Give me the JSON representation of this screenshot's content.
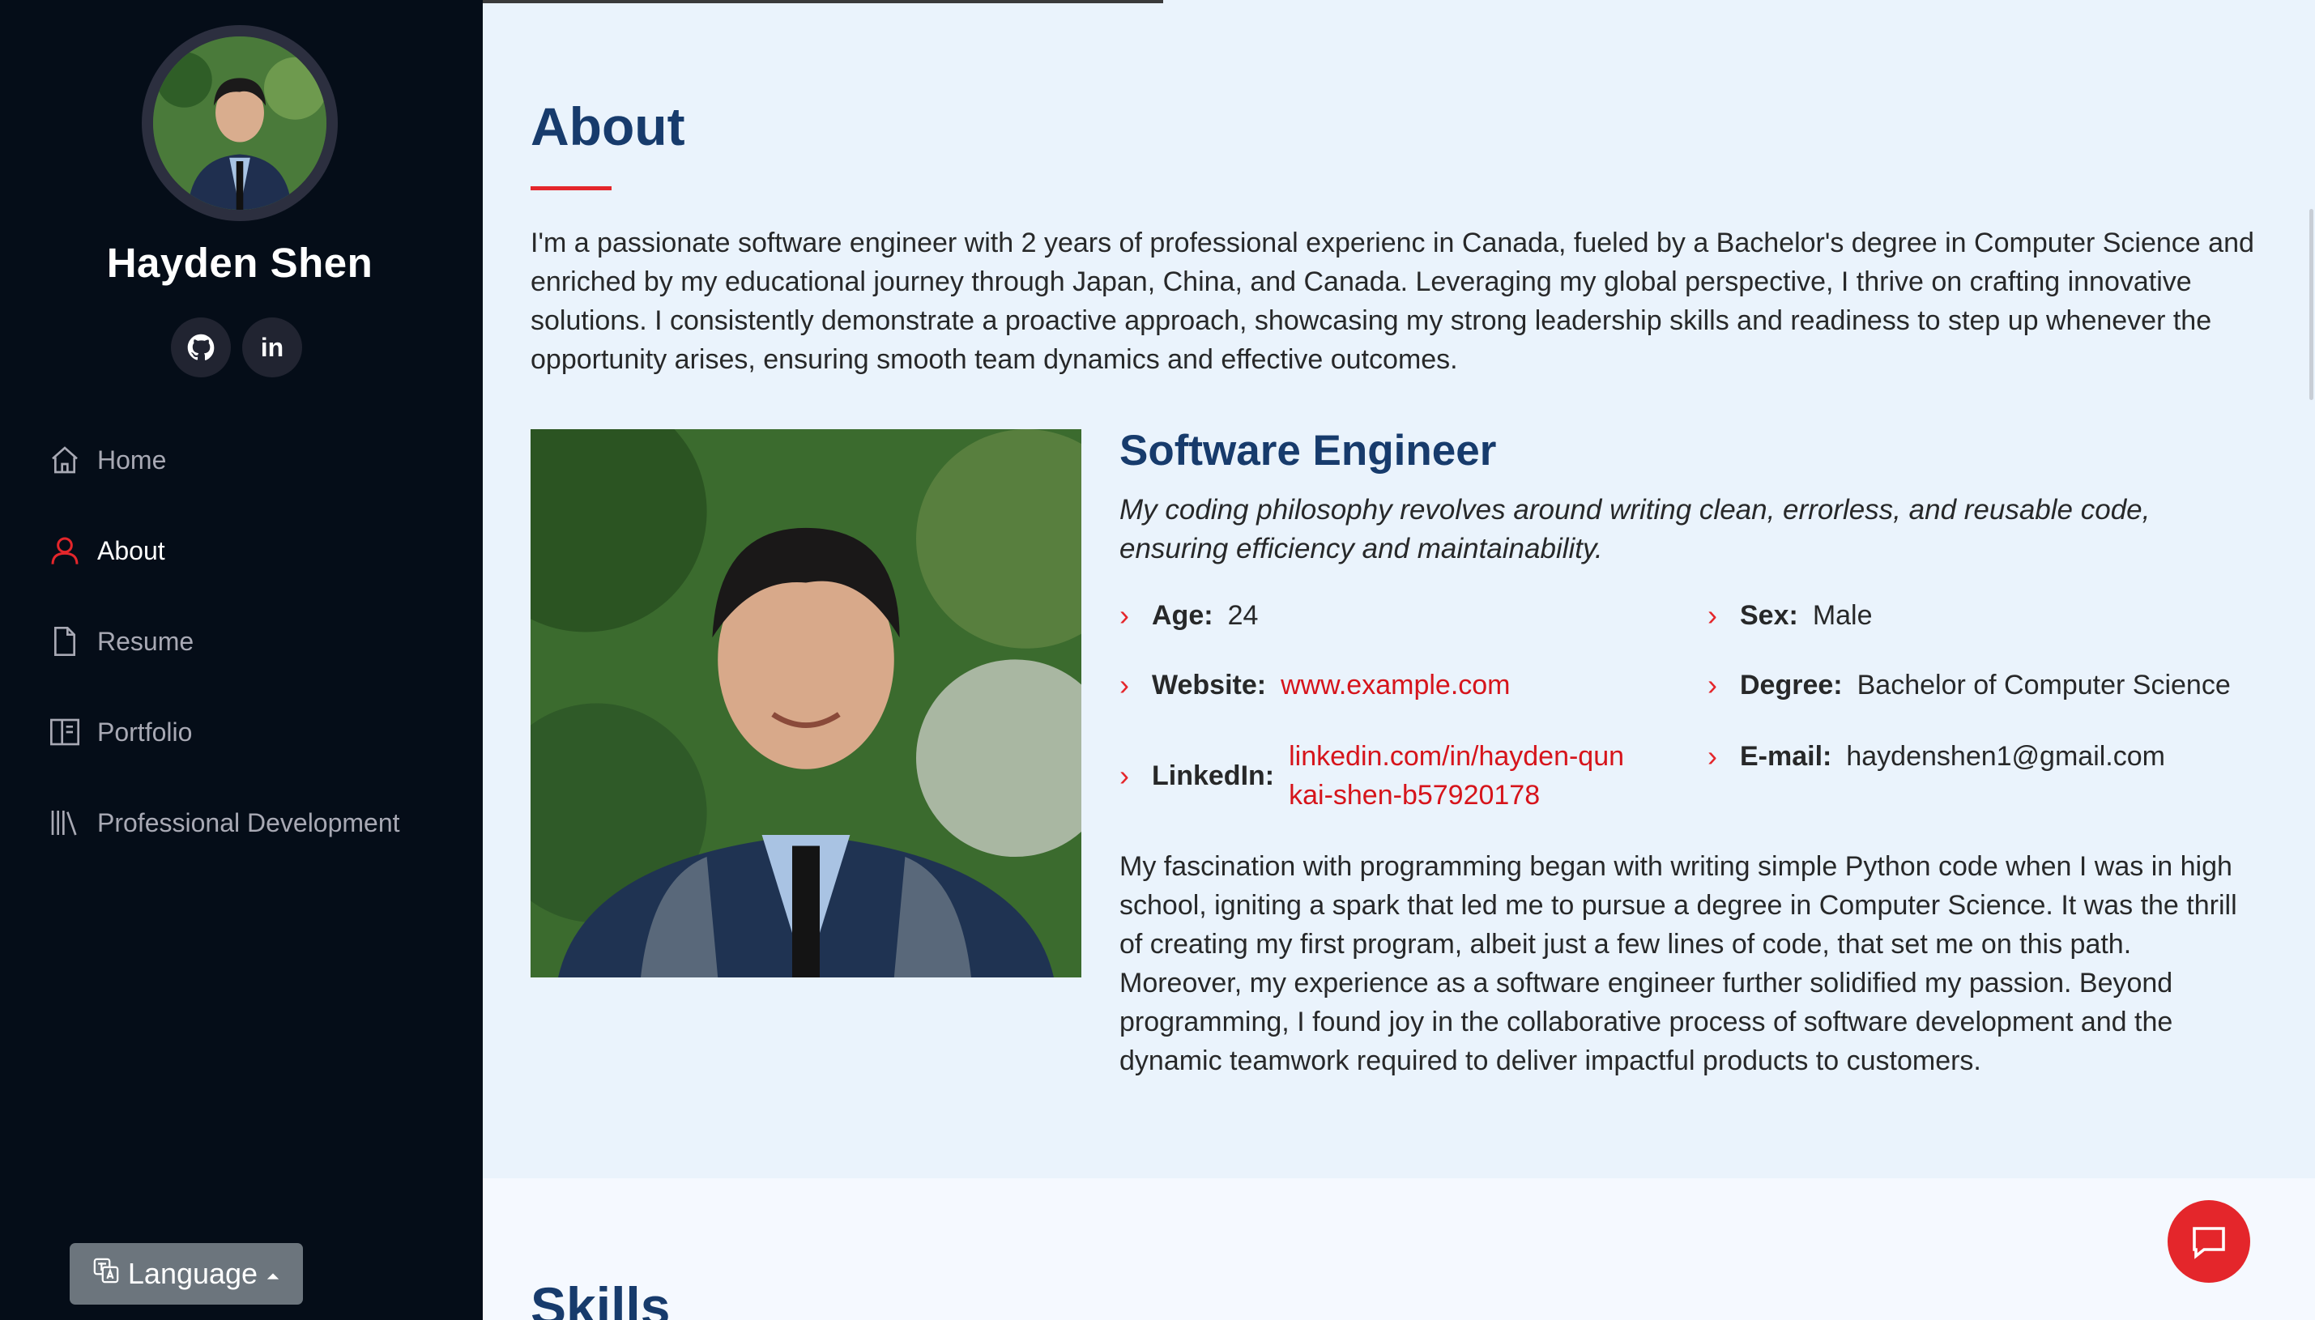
{
  "profile": {
    "name": "Hayden Shen",
    "social": {
      "github_icon": "github-icon",
      "linkedin_label": "in"
    }
  },
  "nav": [
    {
      "label": "Home",
      "icon": "home-icon"
    },
    {
      "label": "About",
      "icon": "person-icon",
      "active": true
    },
    {
      "label": "Resume",
      "icon": "document-icon"
    },
    {
      "label": "Portfolio",
      "icon": "portfolio-icon"
    },
    {
      "label": "Professional Development",
      "icon": "books-icon"
    }
  ],
  "language": {
    "label": "Language"
  },
  "about": {
    "title": "About",
    "intro": "I'm a passionate software engineer with 2 years of professional experienc in Canada, fueled by a Bachelor's degree in Computer Science and enriched by my educational journey through Japan, China, and Canada. Leveraging my global perspective, I thrive on crafting innovative solutions. I consistently demonstrate a proactive approach, showcasing my strong leadership skills and readiness to step up whenever the opportunity arises, ensuring smooth team dynamics and effective outcomes.",
    "role": "Software Engineer",
    "philosophy": "My coding philosophy revolves around writing clean, errorless, and reusable code, ensuring efficiency and maintainability.",
    "details": {
      "age": {
        "label": "Age:",
        "value": "24"
      },
      "sex": {
        "label": "Sex:",
        "value": "Male"
      },
      "website": {
        "label": "Website:",
        "value": "www.example.com"
      },
      "degree": {
        "label": "Degree:",
        "value": "Bachelor of Computer Science"
      },
      "linkedin": {
        "label": "LinkedIn:",
        "value": "linkedin.com/in/hayden-qunkai-shen-b57920178"
      },
      "email": {
        "label": "E-mail:",
        "value": "haydenshen1@gmail.com"
      }
    },
    "story": "My fascination with programming began with writing simple Python code when I was in high school, igniting a spark that led me to pursue a degree in Computer Science. It was the thrill of creating my first program, albeit just a few lines of code, that set me on this path. Moreover, my experience as a software engineer further solidified my passion. Beyond programming, I found joy in the collaborative process of software development and the dynamic teamwork required to deliver impactful products to customers."
  },
  "skills": {
    "title": "Skills"
  },
  "colors": {
    "accent": "#e4262b",
    "heading": "#173b6c",
    "sidebar": "#050d18",
    "background": "#eaf3fc"
  }
}
